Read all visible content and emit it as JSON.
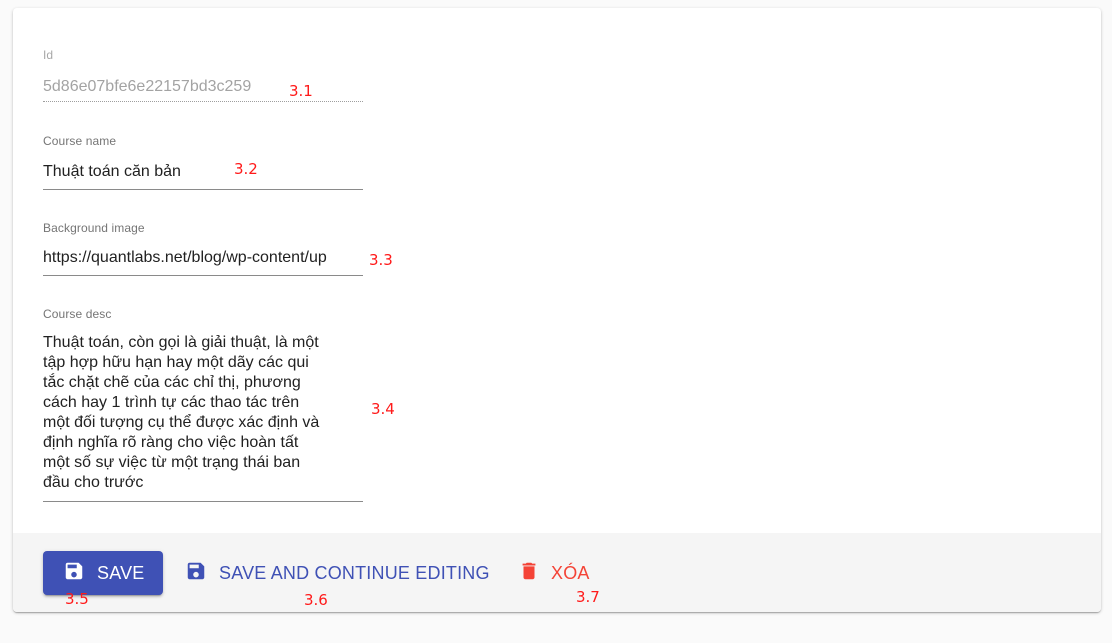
{
  "form": {
    "id_field": {
      "label": "Id",
      "value": "5d86e07bfe6e22157bd3c259"
    },
    "name_field": {
      "label": "Course name",
      "value": "Thuật toán căn bản"
    },
    "image_field": {
      "label": "Background image",
      "value": "https://quantlabs.net/blog/wp-content/up"
    },
    "desc_field": {
      "label": "Course desc",
      "value": "Thuật toán, còn gọi là giải thuật, là một\ntập hợp hữu hạn hay một dãy các qui\ntắc chặt chẽ của các chỉ thị, phương\ncách hay 1 trình tự các thao tác trên\nmột đối tượng cụ thể được xác định và\nđịnh nghĩa rõ ràng cho việc hoàn tất\nmột số sự việc từ một trạng thái ban\nđầu cho trước"
    }
  },
  "toolbar": {
    "save_label": "SAVE",
    "save_continue_label": "SAVE AND CONTINUE EDITING",
    "delete_label": "XÓA"
  },
  "annotations": {
    "a1": "3.1",
    "a2": "3.2",
    "a3": "3.3",
    "a4": "3.4",
    "a5": "3.5",
    "a6": "3.6",
    "a7": "3.7"
  },
  "icons": {
    "save": "save-icon",
    "delete": "delete-icon"
  },
  "colors": {
    "primary": "#3f51b5",
    "danger": "#f44336",
    "annotation": "#ff1a1a"
  }
}
